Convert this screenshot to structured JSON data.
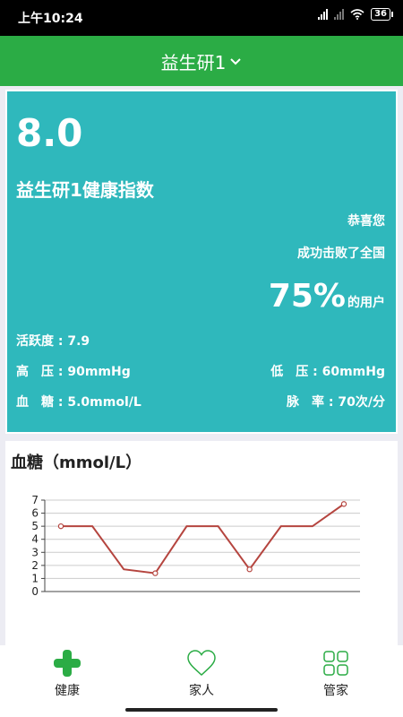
{
  "status_bar": {
    "time": "上午10:24",
    "battery": "36"
  },
  "header": {
    "title": "益生研1",
    "dropdown_icon": "chevron-down-icon"
  },
  "index_card": {
    "score": "8.0",
    "title": "益生研1健康指数",
    "congrats": "恭喜您",
    "beat_text": "成功击败了全国",
    "percent": "75%",
    "percent_suffix": "的用户",
    "activity": "活跃度 : 7.9",
    "high_pressure": "高　压 : 90mmHg",
    "low_pressure": "低　压 : 60mmHg",
    "blood_sugar": "血　糖 : 5.0mmol/L",
    "pulse": "脉　率 : 70次/分",
    "background_color": "#2fb8bc"
  },
  "chart_card": {
    "title": "血糖（mmol/L）"
  },
  "chart_data": {
    "type": "line",
    "title": "血糖（mmol/L）",
    "y_ticks": [
      "0",
      "1",
      "2",
      "3",
      "4",
      "5",
      "6",
      "7"
    ],
    "ylim": [
      0,
      7
    ],
    "grid": true,
    "series": [
      {
        "values": [
          5,
          5,
          1.7,
          1.4,
          5,
          5,
          1.7,
          5,
          5,
          6.7
        ],
        "markers": [
          true,
          false,
          false,
          true,
          false,
          false,
          true,
          false,
          false,
          true
        ],
        "color": "#b5453f"
      }
    ]
  },
  "bottom_nav": {
    "items": [
      {
        "label": "健康",
        "icon": "plus-icon",
        "color": "#2bac45"
      },
      {
        "label": "家人",
        "icon": "heart-outline-icon",
        "color": "#2bac45"
      },
      {
        "label": "管家",
        "icon": "grid-icon",
        "color": "#2bac45"
      }
    ]
  },
  "colors": {
    "primary": "#2bac45",
    "card": "#2fb8bc",
    "line": "#b5453f"
  }
}
